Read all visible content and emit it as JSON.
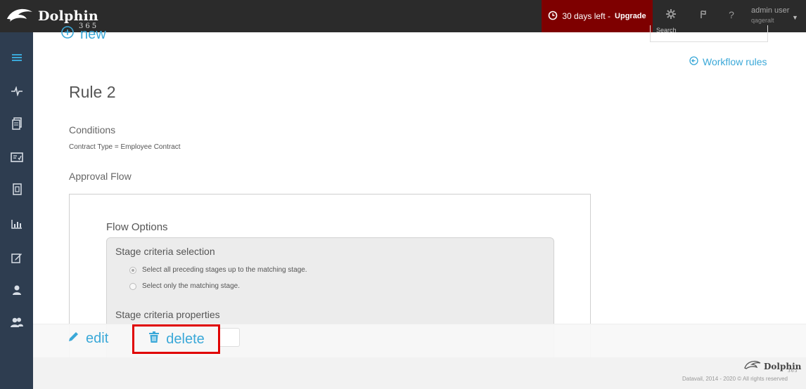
{
  "brand": {
    "name": "Dolphin",
    "sub": "365"
  },
  "topbar": {
    "trial_text": "30 days left - ",
    "upgrade_label": "Upgrade",
    "help_label": "?",
    "user_name": "admin user",
    "user_org": "qageralt"
  },
  "toolbar": {
    "new_label": "new",
    "search_placeholder": "Search"
  },
  "links": {
    "workflow_rules": "Workflow rules"
  },
  "rule": {
    "title": "Rule 2",
    "conditions_heading": "Conditions",
    "conditions_value": "Contract Type = Employee Contract",
    "approval_heading": "Approval Flow"
  },
  "flow": {
    "options_heading": "Flow Options",
    "stage_selection_heading": "Stage criteria selection",
    "radio_all": "Select all preceding stages up to the matching stage.",
    "radio_only": "Select only the matching stage.",
    "stage_properties_heading": "Stage criteria properties"
  },
  "actions": {
    "edit_label": "edit",
    "delete_label": "delete"
  },
  "footer": {
    "logo_name": "Dolphin",
    "logo_sub": "365",
    "copyright": "Datavail, 2014 - 2020 © All rights reserved"
  },
  "colors": {
    "accent": "#3aa8d8",
    "topbar": "#2b2b2b",
    "sidebar": "#2e3d50",
    "trial": "#7e0000",
    "highlight": "#e00000"
  }
}
